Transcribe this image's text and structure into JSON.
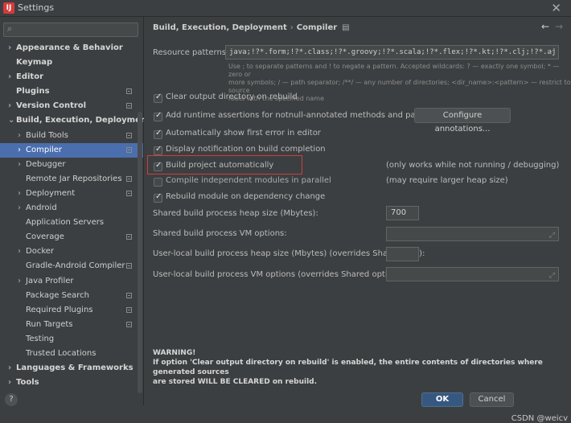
{
  "window": {
    "title": "Settings",
    "app_icon": "intellij-icon"
  },
  "sidebar": {
    "search_placeholder": "",
    "items": [
      {
        "label": "Appearance & Behavior",
        "chevron": "›",
        "bold": true
      },
      {
        "label": "Keymap",
        "chevron": "",
        "bold": true
      },
      {
        "label": "Editor",
        "chevron": "›",
        "bold": true
      },
      {
        "label": "Plugins",
        "chevron": "",
        "bold": true,
        "proj": true
      },
      {
        "label": "Version Control",
        "chevron": "›",
        "bold": true,
        "proj": true
      },
      {
        "label": "Build, Execution, Deployment",
        "chevron": "⌄",
        "bold": true
      },
      {
        "label": "Build Tools",
        "chevron": "›",
        "level": 1,
        "proj": true
      },
      {
        "label": "Compiler",
        "chevron": "›",
        "level": 1,
        "proj": true,
        "selected": true
      },
      {
        "label": "Debugger",
        "chevron": "›",
        "level": 1
      },
      {
        "label": "Remote Jar Repositories",
        "chevron": "",
        "level": 1,
        "proj": true
      },
      {
        "label": "Deployment",
        "chevron": "›",
        "level": 1,
        "proj": true
      },
      {
        "label": "Android",
        "chevron": "›",
        "level": 1
      },
      {
        "label": "Application Servers",
        "chevron": "",
        "level": 1
      },
      {
        "label": "Coverage",
        "chevron": "",
        "level": 1,
        "proj": true
      },
      {
        "label": "Docker",
        "chevron": "›",
        "level": 1
      },
      {
        "label": "Gradle-Android Compiler",
        "chevron": "",
        "level": 1,
        "proj": true
      },
      {
        "label": "Java Profiler",
        "chevron": "›",
        "level": 1
      },
      {
        "label": "Package Search",
        "chevron": "",
        "level": 1,
        "proj": true
      },
      {
        "label": "Required Plugins",
        "chevron": "",
        "level": 1,
        "proj": true
      },
      {
        "label": "Run Targets",
        "chevron": "",
        "level": 1,
        "proj": true
      },
      {
        "label": "Testing",
        "chevron": "",
        "level": 1
      },
      {
        "label": "Trusted Locations",
        "chevron": "",
        "level": 1
      },
      {
        "label": "Languages & Frameworks",
        "chevron": "›",
        "bold": true
      },
      {
        "label": "Tools",
        "chevron": "›",
        "bold": true
      }
    ]
  },
  "breadcrumb": {
    "parent": "Build, Execution, Deployment",
    "separator": "›",
    "current": "Compiler",
    "icon": "▤"
  },
  "resource_patterns": {
    "label": "Resource patterns:",
    "value": "java;!?*.form;!?*.class;!?*.groovy;!?*.scala;!?*.flex;!?*.kt;!?*.clj;!?*.aj",
    "hint_line1": "Use ; to separate patterns and ! to negate a pattern. Accepted wildcards: ? — exactly one symbol; * — zero or",
    "hint_line2": "more symbols; / — path separator; /**/ — any number of directories; <dir_name>:<pattern> — restrict to source",
    "hint_line3": "roots with the specified name"
  },
  "options": [
    {
      "label": "Clear output directory on rebuild",
      "checked": true
    },
    {
      "label": "Add runtime assertions for notnull-annotated methods and parameters",
      "checked": true
    },
    {
      "label": "Automatically show first error in editor",
      "checked": true
    },
    {
      "label": "Display notification on build completion",
      "checked": true
    },
    {
      "label": "Build project automatically",
      "checked": true,
      "note": "(only works while not running / debugging)"
    },
    {
      "label": "Compile independent modules in parallel",
      "checked": false,
      "note": "(may require larger heap size)"
    },
    {
      "label": "Rebuild module on dependency change",
      "checked": true
    }
  ],
  "configure_annotations_label": "Configure annotations...",
  "heap_size": {
    "label": "Shared build process heap size (Mbytes):",
    "value": "700"
  },
  "vm_options": {
    "label": "Shared build process VM options:",
    "value": ""
  },
  "user_heap": {
    "label": "User-local build process heap size (Mbytes) (overrides Shared size):",
    "value": ""
  },
  "user_vm": {
    "label": "User-local build process VM options (overrides Shared options):",
    "value": ""
  },
  "warning": {
    "title": "WARNING!",
    "line1": "If option 'Clear output directory on rebuild' is enabled, the entire contents of directories where generated sources",
    "line2": "are stored WILL BE CLEARED on rebuild."
  },
  "buttons": {
    "ok": "OK",
    "cancel": "Cancel"
  },
  "help_label": "?",
  "watermark": "CSDN @weicv",
  "colors": {
    "accent": "#4b6eaf",
    "highlight_border": "#d13d3d",
    "primary_button": "#365880"
  }
}
